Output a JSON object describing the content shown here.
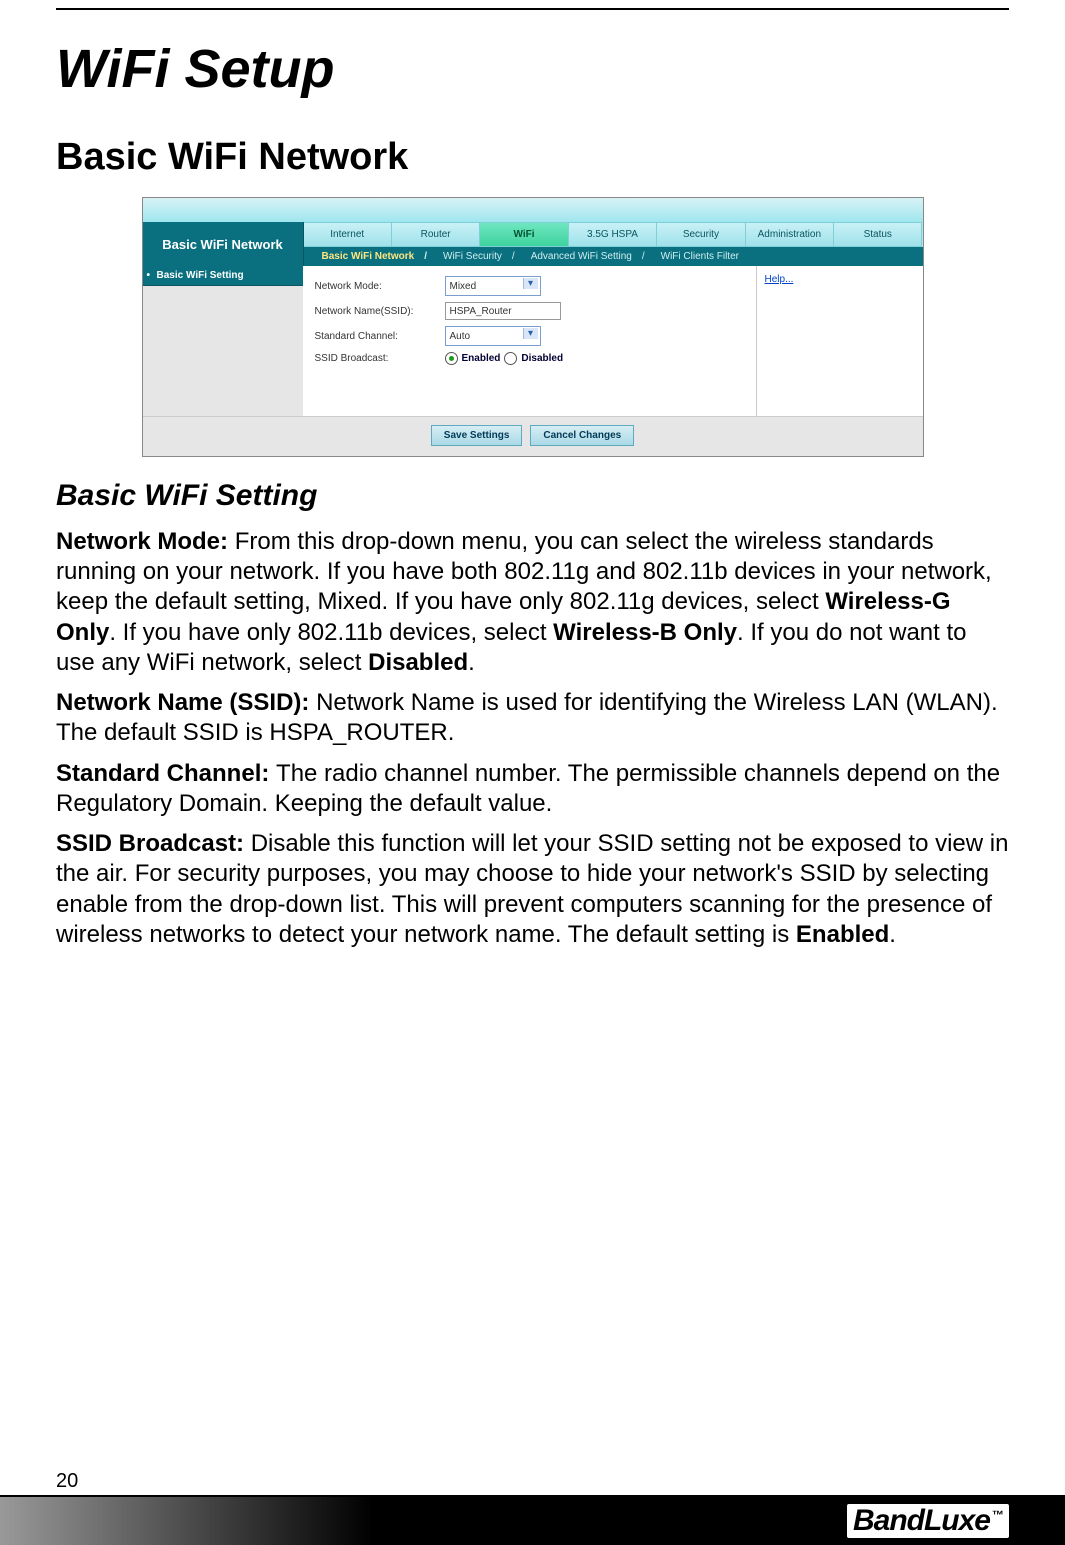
{
  "page": {
    "number": "20",
    "brand": "BandLuxe",
    "brand_tm": "™"
  },
  "headings": {
    "chapter": "WiFi Setup",
    "section": "Basic WiFi Network",
    "subsection": "Basic WiFi Setting"
  },
  "router": {
    "title": "Basic WiFi Network",
    "tabs": [
      "Internet",
      "Router",
      "WiFi",
      "3.5G HSPA",
      "Security",
      "Administration",
      "Status"
    ],
    "active_tab_index": 2,
    "subtabs": [
      "Basic WiFi Network",
      "WiFi Security",
      "Advanced WiFi Setting",
      "WiFi Clients Filter"
    ],
    "active_subtab_index": 0,
    "side_item": "Basic WiFi Setting",
    "help_link": "Help...",
    "form": {
      "network_mode": {
        "label": "Network Mode:",
        "value": "Mixed"
      },
      "ssid": {
        "label": "Network Name(SSID):",
        "value": "HSPA_Router"
      },
      "channel": {
        "label": "Standard Channel:",
        "value": "Auto"
      },
      "broadcast": {
        "label": "SSID Broadcast:",
        "enabled": "Enabled",
        "disabled": "Disabled",
        "selected": "enabled"
      }
    },
    "buttons": {
      "save": "Save Settings",
      "cancel": "Cancel Changes"
    }
  },
  "paragraphs": {
    "p1_lead": "Network Mode: ",
    "p1_a": "From this drop-down menu, you can select the wireless standards running on your network. If you have both 802.11g and 802.11b devices in your network, keep the default setting, Mixed. If you have only 802.11g devices, select ",
    "p1_bold1": "Wireless-G Only",
    "p1_b": ". If you have only 802.11b devices, select ",
    "p1_bold2": "Wireless-B Only",
    "p1_c": ". If you do not want to use any WiFi network, select ",
    "p1_bold3": "Disabled",
    "p1_d": ".",
    "p2_lead": "Network Name (SSID): ",
    "p2_a": "Network Name is used for identifying the Wireless LAN (WLAN). The default SSID is HSPA_ROUTER.",
    "p3_lead": "Standard Channel: ",
    "p3_a": "The radio channel number. The permissible channels depend on the Regulatory Domain. Keeping the default value.",
    "p4_lead": "SSID Broadcast: ",
    "p4_a": "Disable this function will let your SSID setting not be exposed to view in the air. For security purposes, you may choose to hide your network's SSID by selecting enable from the drop-down list. This will prevent computers scanning for the presence of wireless networks to detect your network name. The default setting is ",
    "p4_bold1": "Enabled",
    "p4_b": "."
  }
}
